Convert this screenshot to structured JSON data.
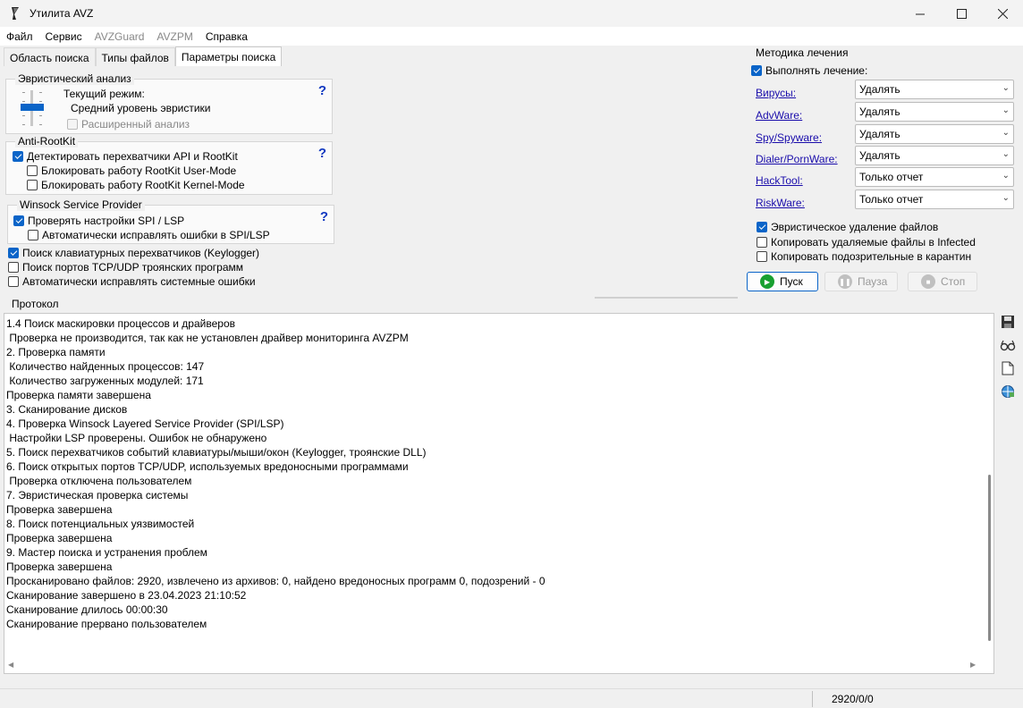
{
  "window": {
    "title": "Утилита AVZ",
    "controls": [
      "minimize-icon",
      "maximize-icon",
      "close-icon"
    ]
  },
  "menu": [
    "Файл",
    "Сервис",
    "AVZGuard",
    "AVZPM",
    "Справка"
  ],
  "tabs": [
    "Область поиска",
    "Типы файлов",
    "Параметры поиска"
  ],
  "heuristic": {
    "legend": "Эвристический анализ",
    "mode_label": "Текущий режим:",
    "mode_value": "Средний уровень эвристики",
    "extended": "Расширенный анализ",
    "help": "?"
  },
  "antirootkit": {
    "legend": "Anti-RootKit",
    "detect": "Детектировать перехватчики API и RootKit",
    "block_user": "Блокировать работу RootKit User-Mode",
    "block_kernel": "Блокировать работу RootKit Kernel-Mode",
    "help": "?"
  },
  "winsock": {
    "legend": "Winsock  Service Provider",
    "check_spi": "Проверять настройки SPI / LSP",
    "autofix": "Автоматически исправлять ошибки в SPI/LSP",
    "help": "?"
  },
  "options": {
    "keylogger": "Поиск клавиатурных перехватчиков (Keylogger)",
    "ports": "Поиск портов TCP/UDP троянских программ",
    "autofix_system": "Автоматически исправлять системные ошибки"
  },
  "treatment": {
    "legend": "Методика лечения",
    "perform": "Выполнять лечение:",
    "rows": [
      {
        "label": "Вирусы:",
        "value": "Удалять"
      },
      {
        "label": "AdvWare:",
        "value": "Удалять"
      },
      {
        "label": "Spy/Spyware:",
        "value": "Удалять"
      },
      {
        "label": "Dialer/PornWare:",
        "value": "Удалять"
      },
      {
        "label": "HackTool:",
        "value": "Только отчет"
      },
      {
        "label": "RiskWare:",
        "value": "Только отчет"
      }
    ],
    "heuristic_delete": "Эвристическое удаление файлов",
    "copy_deleted": "Копировать удаляемые файлы в  Infected",
    "copy_suspicious": "Копировать подозрительные в  карантин"
  },
  "buttons": {
    "start": "Пуск",
    "pause": "Пауза",
    "stop": "Стоп"
  },
  "protocol": {
    "label": "Протокол",
    "lines": [
      "1.4 Поиск маскировки процессов и драйверов",
      " Проверка не производится, так как не установлен драйвер мониторинга AVZPM",
      "2. Проверка памяти",
      " Количество найденных процессов: 147",
      " Количество загруженных модулей: 171",
      "Проверка памяти завершена",
      "3. Сканирование дисков",
      "4. Проверка Winsock Layered Service Provider (SPI/LSP)",
      " Настройки LSP проверены. Ошибок не обнаружено",
      "5. Поиск перехватчиков событий клавиатуры/мыши/окон (Keylogger, троянские DLL)",
      "6. Поиск открытых портов TCP/UDP, используемых вредоносными программами",
      " Проверка отключена пользователем",
      "7. Эвристическая проверка системы",
      "Проверка завершена",
      "8. Поиск потенциальных уязвимостей",
      "Проверка завершена",
      "9. Мастер поиска и устранения проблем",
      "Проверка завершена",
      "Просканировано файлов: 2920, извлечено из архивов: 0, найдено вредоносных программ 0, подозрений - 0",
      "Сканирование завершено в 23.04.2023 21:10:52",
      "Сканирование длилось 00:00:30",
      "Сканирование прервано пользователем"
    ]
  },
  "status": {
    "counts": "2920/0/0"
  }
}
